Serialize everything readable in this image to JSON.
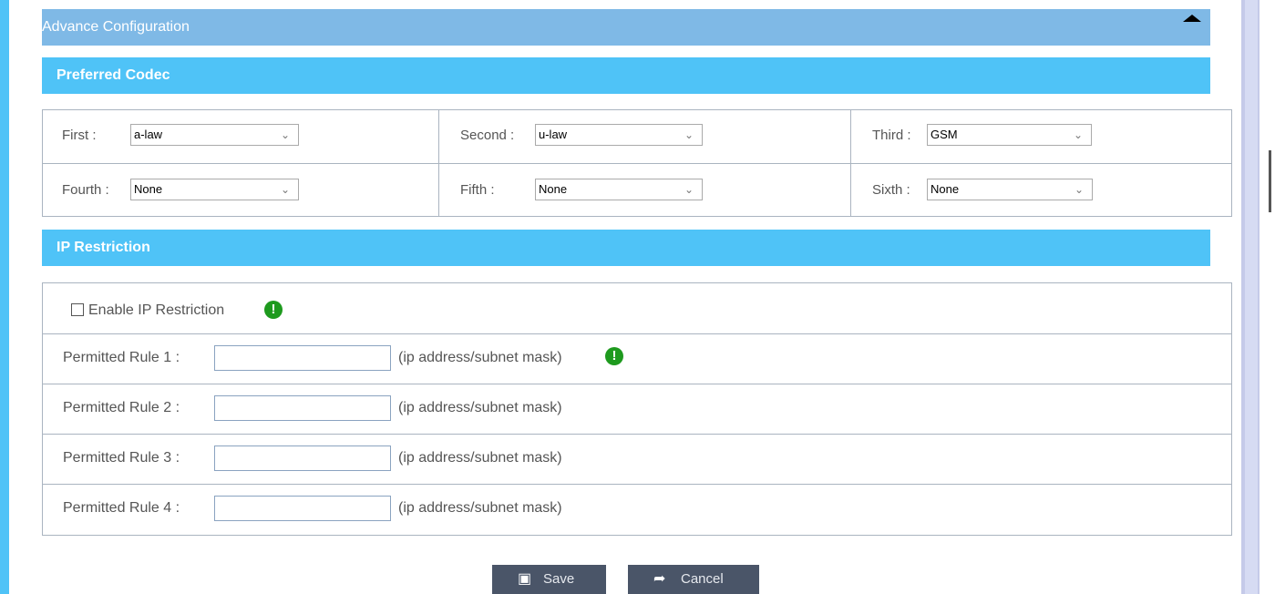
{
  "advance": {
    "title": "Advance Configuration"
  },
  "codec": {
    "header": "Preferred Codec",
    "first": {
      "label": "First :",
      "value": "a-law"
    },
    "second": {
      "label": "Second :",
      "value": "u-law"
    },
    "third": {
      "label": "Third :",
      "value": "GSM"
    },
    "fourth": {
      "label": "Fourth :",
      "value": "None"
    },
    "fifth": {
      "label": "Fifth :",
      "value": "None"
    },
    "sixth": {
      "label": "Sixth :",
      "value": "None"
    }
  },
  "ip": {
    "header": "IP Restriction",
    "enable_label": "Enable IP Restriction",
    "enable_checked": false,
    "hint": "(ip address/subnet mask)",
    "rules": [
      {
        "label": "Permitted Rule 1 :",
        "value": ""
      },
      {
        "label": "Permitted Rule 2 :",
        "value": ""
      },
      {
        "label": "Permitted Rule 3 :",
        "value": ""
      },
      {
        "label": "Permitted Rule 4 :",
        "value": ""
      }
    ]
  },
  "icons": {
    "collapse": "caret-up-icon",
    "info": "exclamation-circle-icon",
    "save": "floppy-disk-icon",
    "cancel": "share-arrow-icon",
    "chevron": "chevron-down-icon"
  },
  "colors": {
    "section": "#4fc3f7",
    "advance": "#7fb9e6",
    "info_green": "#1e9a1e",
    "button": "#4a5568"
  },
  "buttons": {
    "save": "Save",
    "cancel": "Cancel"
  }
}
